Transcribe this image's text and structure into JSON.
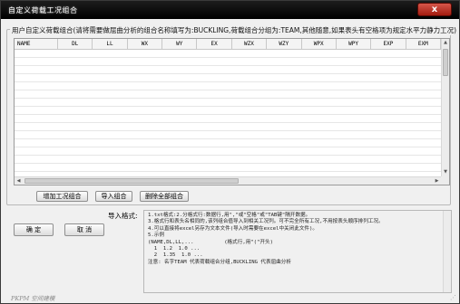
{
  "window": {
    "title": "自定义荷载工况组合",
    "close_label": "x"
  },
  "group": {
    "legend": "用户自定义荷载组合(请将需要做屈曲分析的组合名称填写为:BUCKLING,荷载组合分组为:TEAM,其他随意,如果表头有空格项为规定水平力静力工况)"
  },
  "table": {
    "columns": [
      "NAME",
      "DL",
      "LL",
      "WX",
      "WY",
      "EX",
      "WZX",
      "WZY",
      "WPX",
      "WPY",
      "EXP",
      "EXM"
    ]
  },
  "buttons": {
    "add_case": "增加工况组合",
    "import": "导入组合",
    "delete_all": "删除全部组合",
    "ok": "确 定",
    "cancel": "取 消"
  },
  "import_label": "导入格式:",
  "help_text": "1.txt格式:2.分格式行:数据行,用\",\"或\"空格\"或\"TAB键\"隔开数据。\n3.格式行和表头名相同的,该列组合值导入到相关工况列。可不完全所有工况,不用按表头顺序排列工况。\n4.可以直接将excel另存为文本文件(导入时需要在excel中关闭此文件)。\n5.示例\n(NAME,DL,LL,...          (格式行,用\"(\"开头)\n  1  1.2  1.0 ...\n  2  1.35  1.0 ...\n注意: 名字TEAM 代表荷载组合分组,BUCKLING 代表屈曲分析",
  "watermark": "PKPM 空间建模"
}
